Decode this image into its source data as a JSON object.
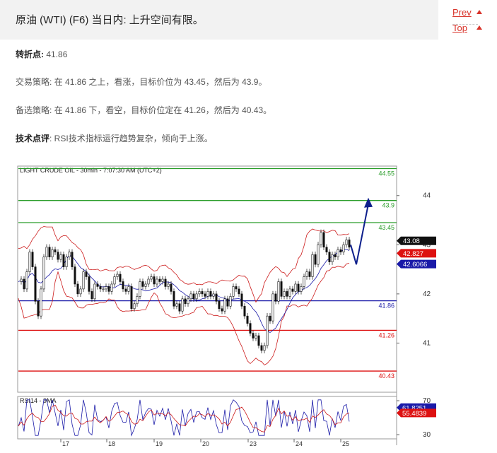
{
  "header": {
    "title": "原油 (WTI) (F6) 当日内: 上升空间有限。"
  },
  "nav": {
    "prev": "Prev",
    "top": "Top"
  },
  "analysis": {
    "pivot_label": "转折点:",
    "pivot_value": "41.86",
    "strategy_label": "交易策略:",
    "strategy_text": "在 41.86 之上，看涨，目标价位为 43.45，然后为 43.9。",
    "alt_label": "备选策略:",
    "alt_text": "在 41.86 下，看空，目标价位定在 41.26，然后为 40.43。",
    "comment_label": "技术点评",
    "comment_text": ": RSI技术指标运行趋势复杂，倾向于上涨。"
  },
  "chart_data": {
    "type": "candlestick",
    "title": "LIGHT CRUDE OIL - 30min - 7:07:30 AM (UTC+2)",
    "ylim": [
      40.0,
      44.6
    ],
    "y_ticks": [
      "44",
      "43",
      "42",
      "41"
    ],
    "x_ticks": [
      "17",
      "18",
      "19",
      "20",
      "23",
      "24",
      "25"
    ],
    "levels": [
      {
        "value": 44.55,
        "label": "44.55",
        "color": "#2a9d2a"
      },
      {
        "value": 43.9,
        "label": "43.9",
        "color": "#2a9d2a"
      },
      {
        "value": 43.45,
        "label": "43.45",
        "color": "#2a9d2a"
      },
      {
        "value": 41.86,
        "label": "41.86",
        "color": "#1a1aa8"
      },
      {
        "value": 41.26,
        "label": "41.26",
        "color": "#d11"
      },
      {
        "value": 40.43,
        "label": "40.43",
        "color": "#d11"
      }
    ],
    "price_tags": [
      {
        "value": 43.08,
        "label": "43.08",
        "bg": "#111",
        "fg": "#fff"
      },
      {
        "value": 42.827,
        "label": "42.827",
        "bg": "#d11",
        "fg": "#fff"
      },
      {
        "value": 42.6066,
        "label": "42.6066",
        "bg": "#1a1aa8",
        "fg": "#fff"
      }
    ],
    "rsi": {
      "title": "RSI14 - 9MA",
      "ylim": [
        25,
        75
      ],
      "y_ticks": [
        "70",
        "30"
      ],
      "tags": [
        {
          "value": 61.8251,
          "label": "61.8251",
          "bg": "#1a1aa8"
        },
        {
          "value": 55.4839,
          "label": "55.4839",
          "bg": "#d11"
        }
      ]
    },
    "price_path": [
      [
        0,
        42.25
      ],
      [
        4,
        42.3
      ],
      [
        8,
        42.1
      ],
      [
        12,
        42.45
      ],
      [
        16,
        42.85
      ],
      [
        20,
        42.55
      ],
      [
        24,
        41.85
      ],
      [
        28,
        41.55
      ],
      [
        32,
        42.1
      ],
      [
        36,
        42.75
      ],
      [
        40,
        42.95
      ],
      [
        44,
        42.75
      ],
      [
        48,
        42.9
      ],
      [
        52,
        42.85
      ],
      [
        56,
        42.7
      ],
      [
        60,
        42.8
      ],
      [
        64,
        42.55
      ],
      [
        68,
        42.75
      ],
      [
        72,
        42.85
      ],
      [
        76,
        42.55
      ],
      [
        80,
        42.2
      ],
      [
        84,
        42.0
      ],
      [
        88,
        42.1
      ],
      [
        92,
        42.45
      ],
      [
        96,
        42.35
      ],
      [
        100,
        42.05
      ],
      [
        104,
        41.9
      ],
      [
        108,
        42.2
      ],
      [
        112,
        42.15
      ],
      [
        116,
        42.1
      ],
      [
        120,
        42.1
      ],
      [
        124,
        42.15
      ],
      [
        128,
        42.05
      ],
      [
        132,
        42.2
      ],
      [
        136,
        42.35
      ],
      [
        140,
        42.4
      ],
      [
        144,
        42.25
      ],
      [
        148,
        42.1
      ],
      [
        152,
        42.05
      ],
      [
        156,
        42.15
      ],
      [
        160,
        41.7
      ],
      [
        164,
        41.8
      ],
      [
        168,
        41.95
      ],
      [
        172,
        42.25
      ],
      [
        176,
        42.15
      ],
      [
        180,
        42.2
      ],
      [
        184,
        42.3
      ],
      [
        188,
        42.35
      ],
      [
        192,
        42.2
      ],
      [
        196,
        42.3
      ],
      [
        200,
        42.25
      ],
      [
        204,
        42.3
      ],
      [
        208,
        42.15
      ],
      [
        212,
        42.2
      ],
      [
        216,
        42.05
      ],
      [
        220,
        41.75
      ],
      [
        224,
        41.8
      ],
      [
        228,
        41.65
      ],
      [
        232,
        41.9
      ],
      [
        236,
        41.8
      ],
      [
        240,
        41.9
      ],
      [
        244,
        42.0
      ],
      [
        248,
        41.9
      ],
      [
        252,
        42.0
      ],
      [
        256,
        42.05
      ],
      [
        260,
        42.0
      ],
      [
        264,
        41.95
      ],
      [
        268,
        42.05
      ],
      [
        272,
        41.95
      ],
      [
        276,
        42.0
      ],
      [
        280,
        41.85
      ],
      [
        284,
        41.7
      ],
      [
        288,
        41.65
      ],
      [
        292,
        41.9
      ],
      [
        296,
        41.75
      ],
      [
        300,
        41.95
      ],
      [
        304,
        42.15
      ],
      [
        308,
        42.1
      ],
      [
        312,
        42.0
      ],
      [
        316,
        41.75
      ],
      [
        320,
        41.55
      ],
      [
        324,
        41.4
      ],
      [
        328,
        41.2
      ],
      [
        332,
        41.1
      ],
      [
        336,
        41.15
      ],
      [
        340,
        40.95
      ],
      [
        344,
        40.85
      ],
      [
        348,
        40.95
      ],
      [
        352,
        41.55
      ],
      [
        356,
        41.45
      ],
      [
        360,
        42.0
      ],
      [
        364,
        41.85
      ],
      [
        368,
        42.25
      ],
      [
        372,
        41.95
      ],
      [
        376,
        42.05
      ],
      [
        380,
        41.95
      ],
      [
        384,
        42.1
      ],
      [
        388,
        42.05
      ],
      [
        392,
        42.2
      ],
      [
        396,
        42.05
      ],
      [
        400,
        42.15
      ],
      [
        404,
        42.35
      ],
      [
        408,
        42.45
      ],
      [
        412,
        42.35
      ],
      [
        416,
        42.8
      ],
      [
        420,
        42.6
      ],
      [
        424,
        43.0
      ],
      [
        428,
        43.25
      ],
      [
        432,
        42.95
      ],
      [
        436,
        42.85
      ],
      [
        440,
        42.65
      ],
      [
        444,
        42.8
      ],
      [
        448,
        42.75
      ],
      [
        452,
        42.9
      ],
      [
        456,
        42.85
      ],
      [
        460,
        43.0
      ],
      [
        464,
        43.1
      ],
      [
        468,
        42.95
      ]
    ],
    "projection": [
      [
        470,
        43.0
      ],
      [
        478,
        42.6
      ],
      [
        496,
        43.9
      ]
    ]
  }
}
